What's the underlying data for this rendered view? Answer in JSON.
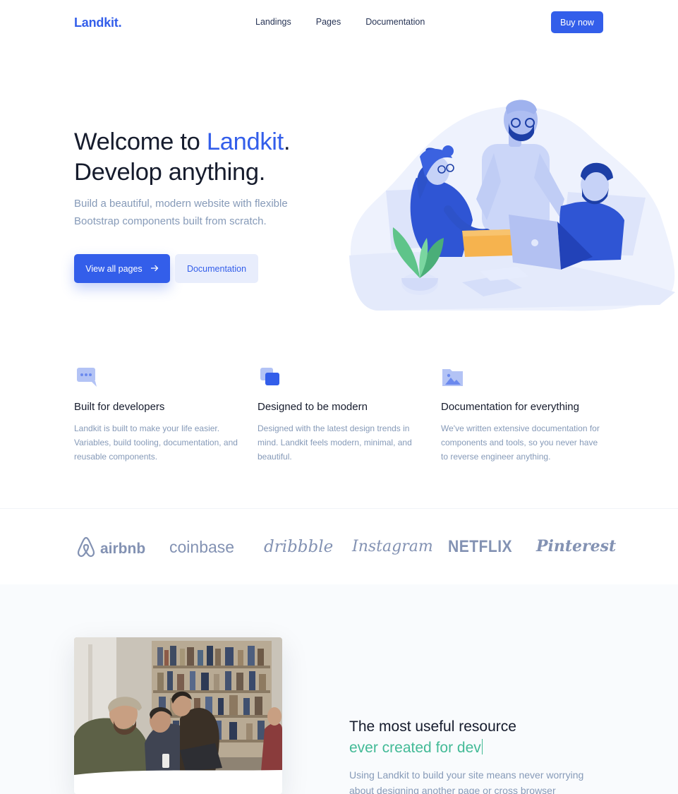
{
  "nav": {
    "brand": "Landkit.",
    "links": [
      "Landings",
      "Pages",
      "Documentation"
    ],
    "buy_label": "Buy now"
  },
  "hero": {
    "title_prefix": "Welcome to ",
    "title_accent": "Landkit",
    "title_suffix": ".",
    "title_line2": "Develop anything.",
    "subtitle": "Build a beautiful, modern website with flexible Bootstrap components built from scratch.",
    "primary_label": "View all pages",
    "primary_icon": "arrow-right-icon",
    "secondary_label": "Documentation"
  },
  "features": [
    {
      "icon": "chat-icon",
      "title": "Built for developers",
      "text": "Landkit is built to make your life easier. Variables, build tooling, documentation, and reusable components."
    },
    {
      "icon": "layers-icon",
      "title": "Designed to be modern",
      "text": "Designed with the latest design trends in mind. Landkit feels modern, minimal, and beautiful."
    },
    {
      "icon": "image-icon",
      "title": "Documentation for everything",
      "text": "We've written extensive documentation for components and tools, so you never have to reverse engineer anything."
    }
  ],
  "brands": [
    "airbnb",
    "coinbase",
    "dribbble",
    "Instagram",
    "NETFLIX",
    "Pinterest"
  ],
  "resource": {
    "title": "The most useful resource",
    "typed": "ever created for dev",
    "text": "Using Landkit to build your site means never worrying about designing another page or cross browser"
  },
  "colors": {
    "primary": "#335eea",
    "primary_soft": "#e8edfc",
    "muted": "#869ab8",
    "dark": "#161c2d",
    "success": "#42ba96"
  }
}
